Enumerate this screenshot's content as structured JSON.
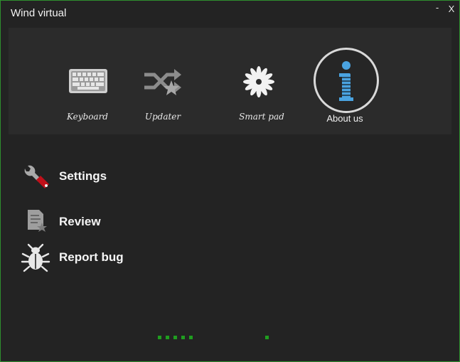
{
  "window": {
    "title": "Wind virtual",
    "minimize": "-",
    "close": "X"
  },
  "toolbar": {
    "keyboard": {
      "label": "Keyboard",
      "icon": "keyboard-icon"
    },
    "updater": {
      "label": "Updater",
      "icon": "shuffle-star-icon"
    },
    "smartpad": {
      "label": "Smart pad",
      "icon": "flower-icon"
    },
    "about": {
      "label": "About us",
      "icon": "info-icon"
    }
  },
  "menu": {
    "settings": {
      "label": "Settings",
      "icon": "wrench-icon"
    },
    "review": {
      "label": "Review",
      "icon": "document-star-icon"
    },
    "report_bug": {
      "label": "Report bug",
      "icon": "bug-icon"
    }
  },
  "colors": {
    "window_bg": "#232323",
    "panel_bg": "#2b2b2b",
    "border": "#2f8f2f",
    "accent_red": "#c0101a",
    "info_blue": "#4aa3e0",
    "progress_green": "#1f9d1f"
  }
}
